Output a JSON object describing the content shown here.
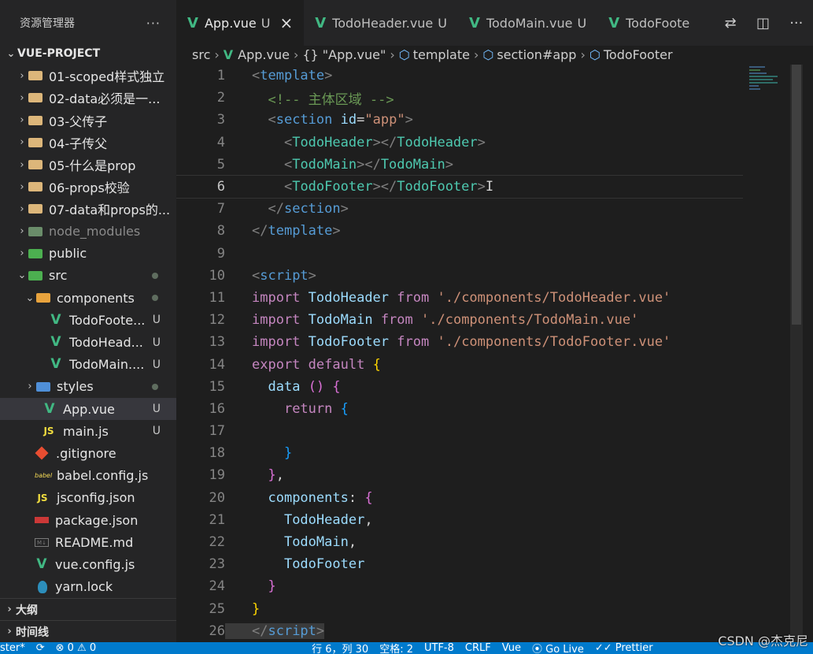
{
  "sidebar": {
    "title": "资源管理器",
    "more": "···",
    "project": "VUE-PROJECT",
    "outline": "大纲",
    "timeline": "时间线",
    "items": [
      {
        "label": "01-scoped样式独立",
        "chev": "›",
        "badge": ""
      },
      {
        "label": "02-data必须是一...",
        "chev": "›",
        "badge": ""
      },
      {
        "label": "03-父传子",
        "chev": "›",
        "badge": ""
      },
      {
        "label": "04-子传父",
        "chev": "›",
        "badge": ""
      },
      {
        "label": "05-什么是prop",
        "chev": "›",
        "badge": ""
      },
      {
        "label": "06-props校验",
        "chev": "›",
        "badge": ""
      },
      {
        "label": "07-data和props的...",
        "chev": "›",
        "badge": ""
      },
      {
        "label": "node_modules",
        "chev": "›",
        "badge": ""
      },
      {
        "label": "public",
        "chev": "›",
        "badge": ""
      },
      {
        "label": "src",
        "chev": "⌄",
        "badge": ""
      },
      {
        "label": "components",
        "chev": "⌄",
        "badge": ""
      },
      {
        "label": "TodoFoote...",
        "badge": "U"
      },
      {
        "label": "TodoHead...",
        "badge": "U"
      },
      {
        "label": "TodoMain....",
        "badge": "U"
      },
      {
        "label": "styles",
        "chev": "›",
        "badge": ""
      },
      {
        "label": "App.vue",
        "badge": "U"
      },
      {
        "label": "main.js",
        "badge": "U",
        "icon": "JS"
      },
      {
        "label": ".gitignore"
      },
      {
        "label": "babel.config.js",
        "icon": "babel"
      },
      {
        "label": "jsconfig.json",
        "icon": "JS"
      },
      {
        "label": "package.json"
      },
      {
        "label": "README.md",
        "icon": "M↓"
      },
      {
        "label": "vue.config.js"
      },
      {
        "label": "yarn.lock"
      }
    ]
  },
  "tabs": [
    {
      "label": "App.vue",
      "status": "U",
      "close": "×"
    },
    {
      "label": "TodoHeader.vue",
      "status": "U"
    },
    {
      "label": "TodoMain.vue",
      "status": "U"
    },
    {
      "label": "TodoFoote"
    }
  ],
  "tab_actions": [
    "⇄",
    "◫",
    "···"
  ],
  "breadcrumb": [
    "src",
    "App.vue",
    "{} \"App.vue\"",
    "template",
    "section#app",
    "TodoFooter"
  ],
  "editor": {
    "current_line": 6,
    "lines": [
      "1",
      "2",
      "3",
      "4",
      "5",
      "6",
      "7",
      "8",
      "9",
      "10",
      "11",
      "12",
      "13",
      "14",
      "15",
      "16",
      "17",
      "18",
      "19",
      "20",
      "21",
      "22",
      "23",
      "24",
      "25",
      "26"
    ]
  },
  "statusbar": {
    "branch": "ster*",
    "errors": "⊗ 0 ⚠ 0",
    "position": "行 6，列 30",
    "spaces": "空格: 2",
    "encoding": "UTF-8",
    "eol": "CRLF",
    "language": "Vue",
    "golive": "⦿ Go Live",
    "prettier": "✓✓ Prettier"
  },
  "watermark": "CSDN @杰克尼"
}
